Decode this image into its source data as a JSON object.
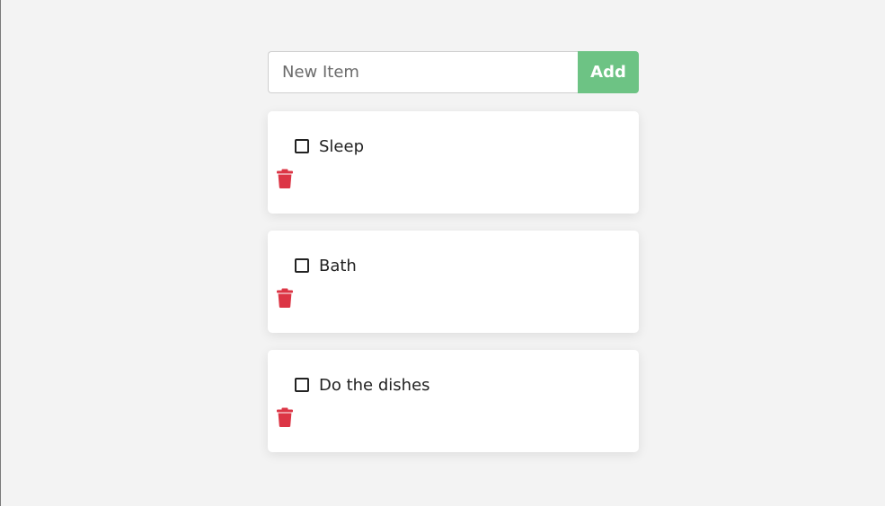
{
  "form": {
    "input_placeholder": "New Item",
    "input_value": "",
    "add_label": "Add"
  },
  "todos": [
    {
      "label": "Sleep",
      "checked": false
    },
    {
      "label": "Bath",
      "checked": false
    },
    {
      "label": "Do the dishes",
      "checked": false
    }
  ],
  "icons": {
    "delete": "trash-icon"
  },
  "colors": {
    "background": "#f3f3f3",
    "add_button": "#6dc384",
    "delete_icon": "#dc3545",
    "card": "#ffffff"
  }
}
